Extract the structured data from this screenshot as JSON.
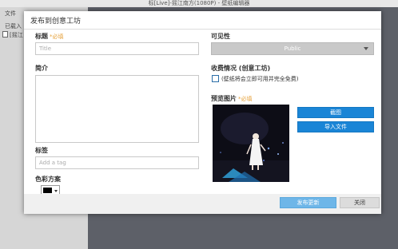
{
  "window": {
    "title": "标[Live]-摇江南方(1080P) - 壁纸编辑器"
  },
  "sidebar": {
    "menu": "文件",
    "loaded_label": "已载入",
    "file_item": "[摇江"
  },
  "dialog": {
    "title": "发布到创意工坊",
    "required_mark": "*必填",
    "title_label": "标题",
    "title_placeholder": "Title",
    "description_label": "简介",
    "tags_label": "标签",
    "tags_placeholder": "Add a tag",
    "color_scheme_label": "色彩方案",
    "color_value": "#000000",
    "visibility_label": "可见性",
    "visibility_value": "Public",
    "pricing_label": "收费情况 (创意工坊)",
    "pricing_checkbox_text": "(壁纸将会立即可用并完全免费)",
    "pricing_checked": false,
    "preview_label": "预览图片",
    "crop_button": "截图",
    "import_button": "导入文件",
    "publish_button": "发布更新",
    "close_button": "关闭"
  }
}
